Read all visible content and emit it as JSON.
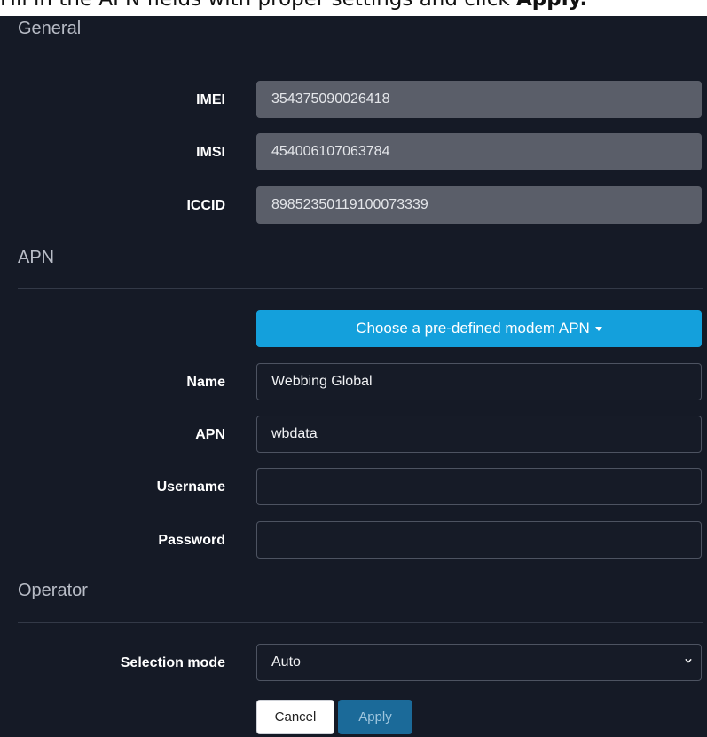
{
  "instruction": {
    "prefix": "Fill in the APN fields with proper settings and click ",
    "action": "Apply."
  },
  "general": {
    "title": "General",
    "imei_label": "IMEI",
    "imei_value": "354375090026418",
    "imsi_label": "IMSI",
    "imsi_value": "454006107063784",
    "iccid_label": "ICCID",
    "iccid_value": "89852350119100073339"
  },
  "apn": {
    "title": "APN",
    "predefined_button": "Choose a pre-defined modem APN",
    "name_label": "Name",
    "name_value": "Webbing Global",
    "apn_label": "APN",
    "apn_value": "wbdata",
    "username_label": "Username",
    "username_value": "",
    "password_label": "Password",
    "password_value": ""
  },
  "operator": {
    "title": "Operator",
    "selection_mode_label": "Selection mode",
    "selection_mode_value": "Auto"
  },
  "actions": {
    "cancel": "Cancel",
    "apply": "Apply"
  },
  "colors": {
    "panel_bg": "#151a26",
    "accent": "#14a0dc",
    "apply_bg": "#1b6a99"
  }
}
